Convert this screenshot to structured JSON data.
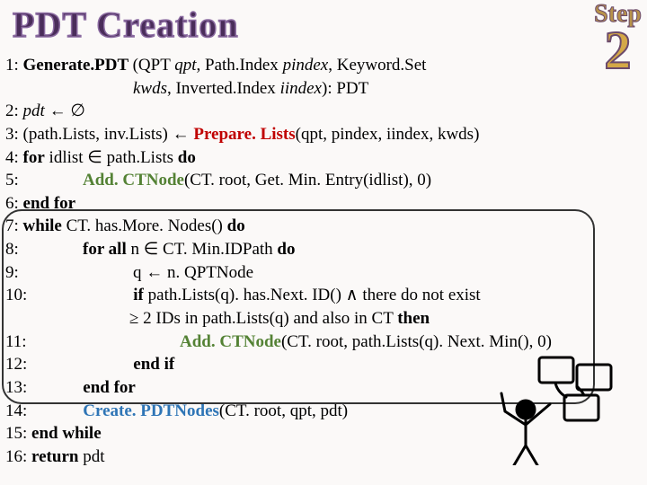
{
  "title": "PDT Creation",
  "step": {
    "label": "Step",
    "number": "2"
  },
  "algo": {
    "l1a": "1: ",
    "l1b": "Generate.PDT ",
    "l1c": "(QPT ",
    "l1d": "qpt",
    "l1e": ", Path.Index ",
    "l1f": "pindex",
    "l1g": ", Keyword.Set",
    "l1h": "kwds",
    "l1i": ", Inverted.Index ",
    "l1j": "iindex",
    "l1k": "): PDT",
    "l2a": "2: ",
    "l2b": "pdt",
    "l2c": " ← ∅",
    "l3a": "3: (path.Lists, inv.Lists) ← ",
    "l3b": "Prepare. Lists",
    "l3c": "(qpt, pindex, iindex, kwds)",
    "l4a": "4: ",
    "l4b": "for",
    "l4c": " idlist ∈ path.Lists ",
    "l4d": "do",
    "l5a": "5: ",
    "l5b": "Add. CTNode",
    "l5c": "(CT. root, Get. Min. Entry(idlist), 0)",
    "l6a": "6: ",
    "l6b": "end for",
    "l7a": "7: ",
    "l7b": "while",
    "l7c": " CT. has.More. Nodes() ",
    "l7d": "do",
    "l8a": "8: ",
    "l8b": "for all",
    "l8c": " n ∈ CT. Min.IDPath ",
    "l8d": "do",
    "l9a": "9: ",
    "l9b": "q ← n. QPTNode",
    "l10a": "10: ",
    "l10b": "if",
    "l10c": " path.Lists(q). has.Next. ID() ∧ there do not exist",
    "l10d": "≥ 2 IDs in path.Lists(q) and also in CT ",
    "l10e": "then",
    "l11a": "11: ",
    "l11b": "Add. CTNode",
    "l11c": "(CT. root, path.Lists(q). Next. Min(), 0)",
    "l12a": "12: ",
    "l12b": "end if",
    "l13a": "13: ",
    "l13b": "end for",
    "l14a": "14: ",
    "l14b": "Create. PDTNodes",
    "l14c": "(CT. root, qpt, pdt)",
    "l15a": "15: ",
    "l15b": "end while",
    "l16a": "16: ",
    "l16b": "return",
    "l16c": " pdt"
  }
}
